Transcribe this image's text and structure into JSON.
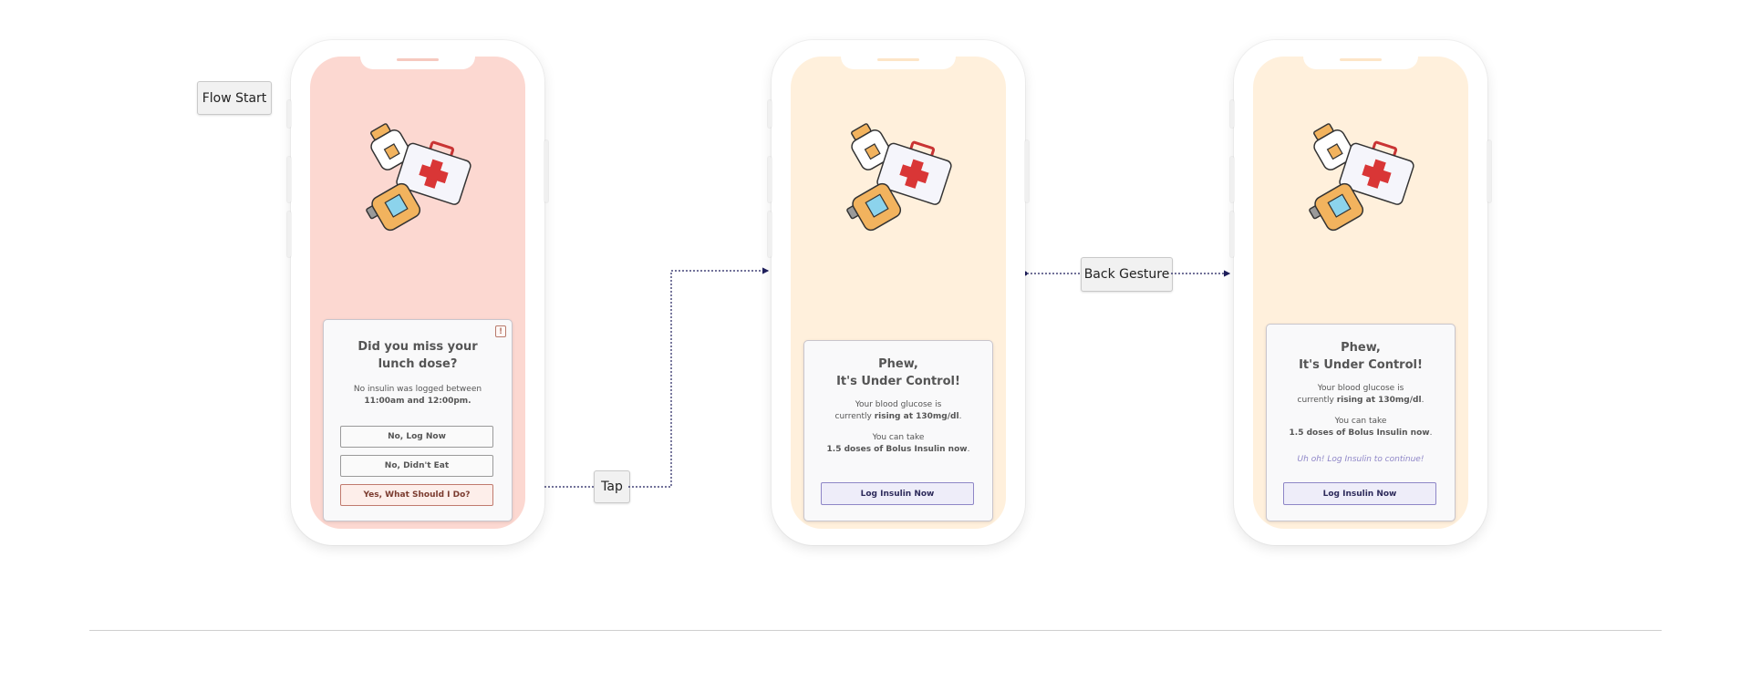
{
  "flow": {
    "start_label": "Flow Start",
    "tap_label": "Tap",
    "back_label": "Back Gesture"
  },
  "screen1": {
    "background": "#fcd8d1",
    "title_line1": "Did you miss your",
    "title_line2": "lunch dose?",
    "text_line1": "No insulin was logged between",
    "text_line2": "11:00am and 12:00pm.",
    "alert_icon": "!",
    "buttons": [
      "No, Log Now",
      "No, Didn't Eat",
      "Yes, What Should I Do?"
    ]
  },
  "screen2": {
    "background": "#fff0dc",
    "title_line1": "Phew,",
    "title_line2": "It's Under Control!",
    "glucose_line1": "Your blood glucose is",
    "glucose_prefix": "currently ",
    "glucose_bold": "rising at 130mg/dl",
    "glucose_suffix": ".",
    "dose_line1": "You can take",
    "dose_bold": "1.5 doses of Bolus Insulin now",
    "dose_suffix": ".",
    "button": "Log Insulin Now"
  },
  "screen3": {
    "background": "#fff0dc",
    "title_line1": "Phew,",
    "title_line2": "It's Under Control!",
    "glucose_line1": "Your blood glucose is",
    "glucose_prefix": "currently ",
    "glucose_bold": "rising at 130mg/dl",
    "glucose_suffix": ".",
    "dose_line1": "You can take",
    "dose_bold": "1.5 doses of Bolus Insulin now",
    "dose_suffix": ".",
    "hint": "Uh oh! Log Insulin to continue!",
    "button": "Log Insulin Now"
  },
  "colors": {
    "accent_purple": "#8e86c7",
    "warning_red": "#c07a6e",
    "connector": "#1f1f5c"
  },
  "icons": [
    "pill-bottle-icon",
    "first-aid-kit-icon",
    "medicine-bottle-icon",
    "alert-icon"
  ]
}
